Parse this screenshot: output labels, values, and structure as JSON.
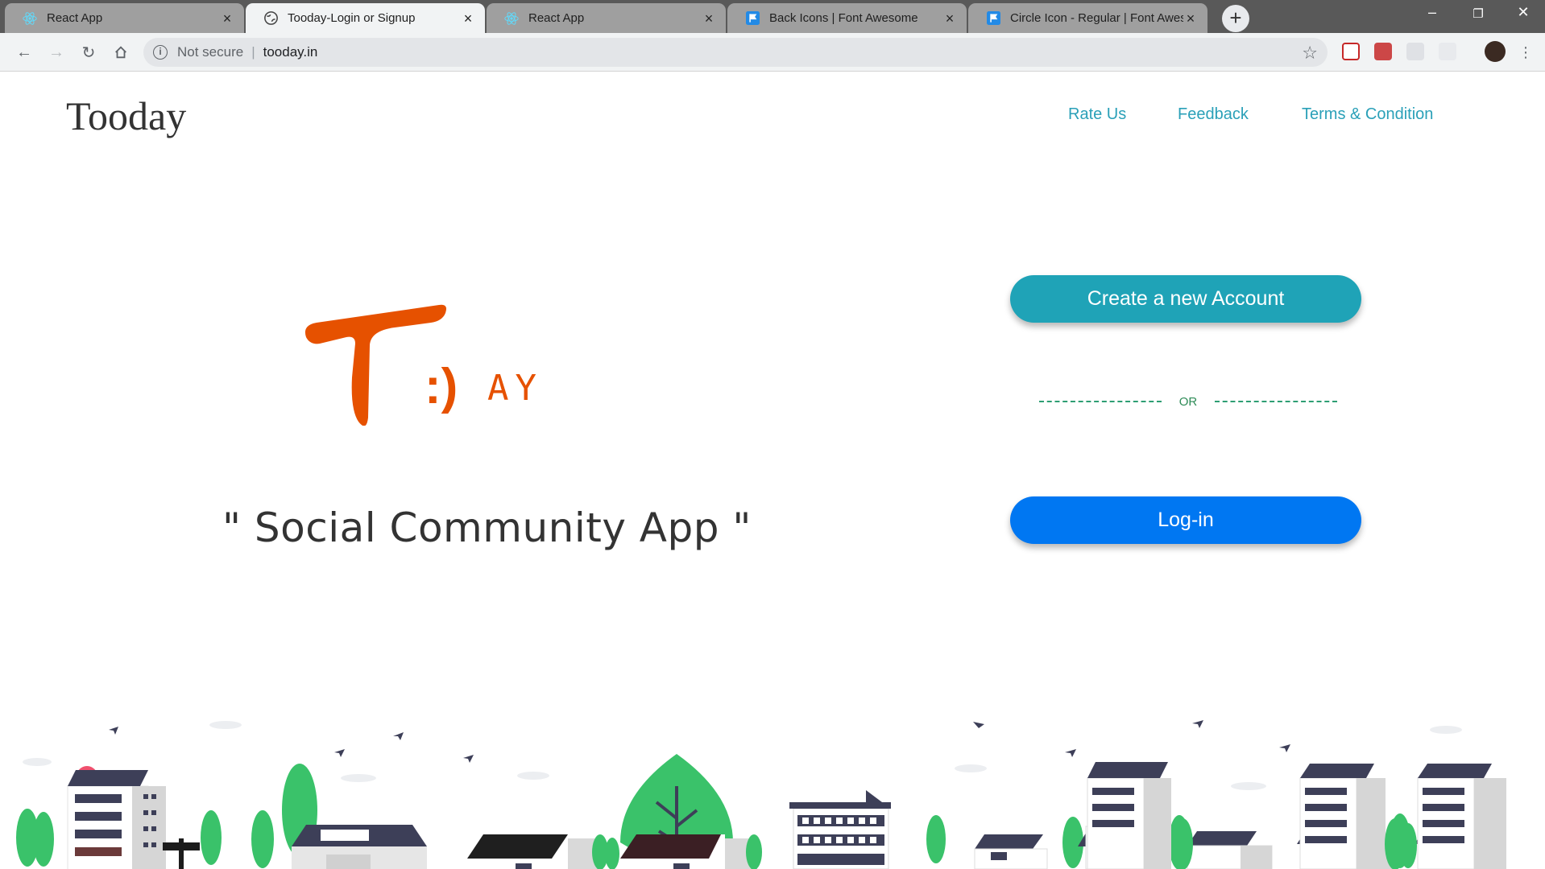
{
  "browser": {
    "tabs": [
      {
        "title": "React App",
        "icon": "react-icon",
        "active": false
      },
      {
        "title": "Tooday-Login or Signup",
        "icon": "globe-icon",
        "active": true
      },
      {
        "title": "React App",
        "icon": "react-icon",
        "active": false
      },
      {
        "title": "Back Icons | Font Awesome",
        "icon": "flag-icon",
        "active": false
      },
      {
        "title": "Circle Icon - Regular | Font Awesome",
        "icon": "flag-icon",
        "active": false
      }
    ],
    "security_label": "Not secure",
    "url": "tooday.in"
  },
  "header": {
    "brand": "Tooday",
    "nav": {
      "rate": "Rate Us",
      "feedback": "Feedback",
      "terms": "Terms & Condition"
    }
  },
  "hero": {
    "logo_letter": "T",
    "logo_face": ":)",
    "logo_suffix": "AY",
    "logo_color": "#e65100",
    "tagline": "\" Social Community App \""
  },
  "auth": {
    "create_label": "Create a new Account",
    "or_label": "OR",
    "login_label": "Log-in",
    "create_color": "#1fa3b7",
    "login_color": "#0077f2"
  }
}
